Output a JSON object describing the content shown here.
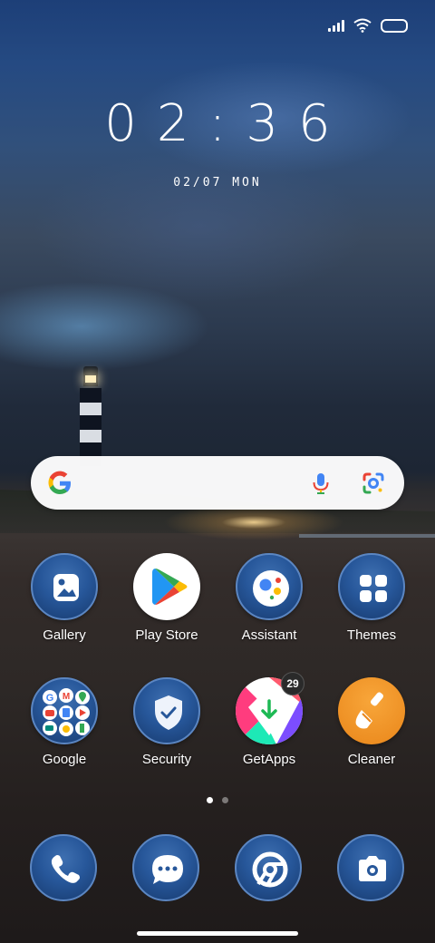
{
  "status_bar": {
    "icons": [
      "signal-icon",
      "wifi-icon",
      "battery-icon"
    ]
  },
  "clock": {
    "time": "02:36",
    "date": "02/07 MON"
  },
  "search_bar": {
    "icons": [
      "google-icon",
      "mic-icon",
      "lens-icon"
    ]
  },
  "apps": [
    {
      "label": "Gallery",
      "icon": "gallery-icon"
    },
    {
      "label": "Play Store",
      "icon": "play-store-icon"
    },
    {
      "label": "Assistant",
      "icon": "assistant-icon"
    },
    {
      "label": "Themes",
      "icon": "themes-icon"
    },
    {
      "label": "Google",
      "icon": "google-folder-icon"
    },
    {
      "label": "Security",
      "icon": "security-icon"
    },
    {
      "label": "GetApps",
      "icon": "getapps-icon",
      "badge": "29"
    },
    {
      "label": "Cleaner",
      "icon": "cleaner-icon"
    }
  ],
  "page_indicator": {
    "pages": 2,
    "current": 1
  },
  "dock": [
    {
      "icon": "phone-icon"
    },
    {
      "icon": "messages-icon"
    },
    {
      "icon": "chrome-icon"
    },
    {
      "icon": "camera-icon"
    }
  ],
  "colors": {
    "icon_blue": "#27579a",
    "cleaner_orange": "#f0921e",
    "google_blue": "#4285f4",
    "google_red": "#ea4335",
    "google_yellow": "#fbbc05",
    "google_green": "#34a853"
  }
}
